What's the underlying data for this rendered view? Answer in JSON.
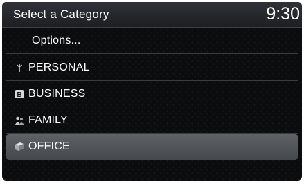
{
  "header": {
    "title": "Select a Category",
    "clock": "9:30"
  },
  "list": {
    "options_label": "Options...",
    "items": [
      {
        "label": "PERSONAL",
        "icon": "personal-icon"
      },
      {
        "label": "BUSINESS",
        "icon": "business-icon"
      },
      {
        "label": "FAMILY",
        "icon": "family-icon"
      },
      {
        "label": "OFFICE",
        "icon": "office-icon",
        "selected": true
      }
    ]
  },
  "colors": {
    "background": "#0b0c0d",
    "title_bar": "#2f3237",
    "selected_row": "#55595d",
    "text": "#ffffff",
    "divider": "#3a3d40"
  }
}
